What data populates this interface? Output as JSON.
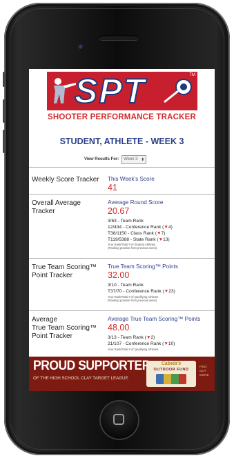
{
  "app": {
    "logo_letters": "SPT",
    "subtitle": "SHOOTER PERFORMANCE TRACKER"
  },
  "page": {
    "title": "STUDENT, ATHLETE - WEEK 3",
    "view_label": "View Results For:",
    "week_select_value": "Week 3"
  },
  "sections": {
    "weekly": {
      "label": "Weekly Score Tracker",
      "heading": "This Week's Score",
      "value": "41"
    },
    "overall": {
      "label_line1": "Overall Average",
      "label_line2": "Tracker",
      "heading": "Average Round Score",
      "value": "20.67",
      "details": [
        "3/63 - Team Rank",
        "12/434 - Conference Rank (",
        "T38/1150 - Class Rank (",
        "T119/5388 - State Rank ("
      ],
      "conference_change": "4",
      "class_change": "7",
      "state_change": "13",
      "note1": "Your Rank/Total # of Student Athletes",
      "note2": "(Ranking position from previous week)"
    },
    "true_team": {
      "label_line1": "True Team Scoring™",
      "label_line2": "Point Tracker",
      "heading": "True Team Scoring™ Points",
      "value": "32.00",
      "details": [
        "3/10 - Team Rank",
        "T37/70 - Conference Rank ("
      ],
      "conference_change": "23",
      "note1": "Your Rank/Total # of Qualifying Athletes",
      "note2": "(Ranking position from previous week)"
    },
    "avg_true_team": {
      "label_line1": "Average",
      "label_line2": "True Team Scoring™",
      "label_line3": "Point Tracker",
      "heading": "Average True Team Scoring™ Points",
      "value": "48.00",
      "details": [
        "3/13 - Team Rank (",
        "21/107 - Conference Rank ("
      ],
      "team_change": "2",
      "conference_change": "10",
      "note1": "Your Rank/Total # of Qualifying Athletes"
    }
  },
  "banner": {
    "headline": "PROUD SUPPORTER",
    "subline": "OF THE HIGH SCHOOL CLAY TARGET LEAGUE",
    "sponsor_name": "Cabela's",
    "sponsor_sub": "OUTDOOR FUND",
    "find_out_more": "FIND OUT MORE"
  },
  "colors": {
    "brand_red": "#d22a2a",
    "brand_blue": "#2d3f89",
    "banner_maroon": "#7d1b13"
  },
  "icons": {
    "rank_change": "down-arrow-icon",
    "home": "home-button-icon"
  }
}
